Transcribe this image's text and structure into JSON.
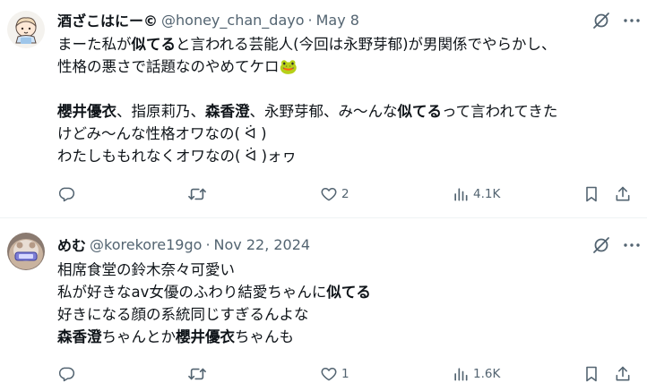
{
  "tweets": [
    {
      "display_name": "酒ざこはにー©",
      "handle": "@honey_chan_dayo",
      "separator": "·",
      "date": "May 8",
      "lines": [
        [
          {
            "t": "まーた私が"
          },
          {
            "t": "似てる",
            "b": true
          },
          {
            "t": "と言われる芸能人(今回は永野芽郁)が男関係でやらかし、"
          }
        ],
        [
          {
            "t": "性格の悪さで話題なのやめてケロ🐸"
          }
        ],
        [],
        [
          {
            "t": "櫻井優衣",
            "b": true
          },
          {
            "t": "、指原莉乃、"
          },
          {
            "t": "森香澄",
            "b": true
          },
          {
            "t": "、永野芽郁、み〜んな"
          },
          {
            "t": "似てる",
            "b": true
          },
          {
            "t": "って言われてきた"
          }
        ],
        [
          {
            "t": "けどみ〜んな性格オワなの( ᐛ )"
          }
        ],
        [
          {
            "t": "わたしももれなくオワなの( ᐛ )ォヮ"
          }
        ]
      ],
      "stats": {
        "replies": "",
        "reposts": "",
        "likes": "2",
        "views": "4.1K"
      }
    },
    {
      "display_name": "めむ",
      "handle": "@korekore19go",
      "separator": "·",
      "date": "Nov 22, 2024",
      "lines": [
        [
          {
            "t": "相席食堂の鈴木奈々可愛い"
          }
        ],
        [
          {
            "t": "私が好きなav女優のふわり結愛ちゃんに"
          },
          {
            "t": "似てる",
            "b": true
          }
        ],
        [
          {
            "t": "好きになる顔の系統同じすぎるんよな"
          }
        ],
        [
          {
            "t": "森香澄",
            "b": true
          },
          {
            "t": "ちゃんとか"
          },
          {
            "t": "櫻井優衣",
            "b": true
          },
          {
            "t": "ちゃんも"
          }
        ]
      ],
      "stats": {
        "replies": "",
        "reposts": "",
        "likes": "1",
        "views": "1.6K"
      }
    }
  ],
  "icons": {
    "more": "more-icon",
    "grok": "grok-icon",
    "reply": "reply-icon",
    "retweet": "retweet-icon",
    "like": "heart-icon",
    "views": "views-icon",
    "bookmark": "bookmark-icon",
    "share": "share-icon"
  },
  "colors": {
    "text": "#0f1419",
    "secondary": "#536471",
    "divider": "#eff3f4"
  }
}
